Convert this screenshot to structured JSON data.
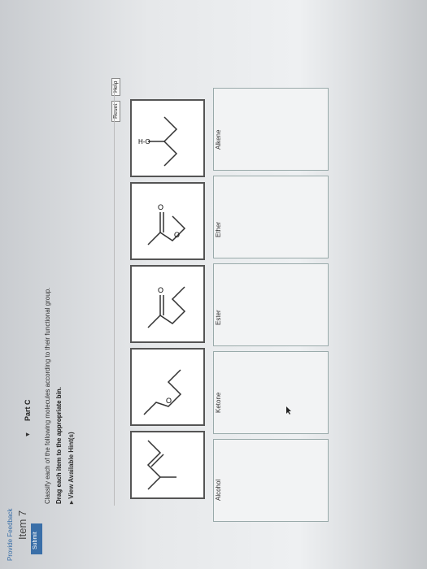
{
  "header": {
    "item_title": "Item 7"
  },
  "part": {
    "title": "Part C",
    "toggle_icon": "triangle-down-icon"
  },
  "instructions": {
    "line1": "Classify each of the following molecules according to their functional group.",
    "line2": "Drag each item to the appropriate bin.",
    "hint_link": "View Available Hint(s)"
  },
  "toolbar": {
    "reset_label": "Reset",
    "help_label": "Help"
  },
  "draggables": [
    {
      "name": "molecule-alkene"
    },
    {
      "name": "molecule-ether-1"
    },
    {
      "name": "molecule-ketone"
    },
    {
      "name": "molecule-ester"
    },
    {
      "name": "molecule-alcohol",
      "label": "H-O"
    }
  ],
  "bins": [
    {
      "label": "Alcohol"
    },
    {
      "label": "Ketone"
    },
    {
      "label": "Ester"
    },
    {
      "label": "Ether"
    },
    {
      "label": "Alkene"
    }
  ],
  "submit_label": "Submit",
  "feedback_link": "Provide Feedback"
}
